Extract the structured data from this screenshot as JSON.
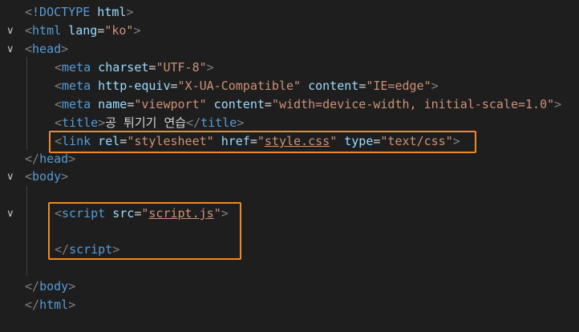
{
  "editor": {
    "lines": [
      {
        "fold": "",
        "tokens": [
          {
            "t": "<",
            "c": "t-br"
          },
          {
            "t": "!DOCTYPE",
            "c": "t-tag"
          },
          {
            "t": " html",
            "c": "t-attr"
          },
          {
            "t": ">",
            "c": "t-br"
          }
        ]
      },
      {
        "fold": "v",
        "tokens": [
          {
            "t": "<",
            "c": "t-br"
          },
          {
            "t": "html",
            "c": "t-tag"
          },
          {
            "t": " lang",
            "c": "t-attr"
          },
          {
            "t": "=",
            "c": "t-eq"
          },
          {
            "t": "\"ko\"",
            "c": "t-str"
          },
          {
            "t": ">",
            "c": "t-br"
          }
        ]
      },
      {
        "fold": "v",
        "tokens": [
          {
            "t": "<",
            "c": "t-br"
          },
          {
            "t": "head",
            "c": "t-tag"
          },
          {
            "t": ">",
            "c": "t-br"
          }
        ]
      },
      {
        "fold": "",
        "tokens": [
          {
            "t": "<",
            "c": "t-br"
          },
          {
            "t": "meta",
            "c": "t-tag"
          },
          {
            "t": " charset",
            "c": "t-attr"
          },
          {
            "t": "=",
            "c": "t-eq"
          },
          {
            "t": "\"UTF-8\"",
            "c": "t-str"
          },
          {
            "t": ">",
            "c": "t-br"
          }
        ]
      },
      {
        "fold": "",
        "tokens": [
          {
            "t": "<",
            "c": "t-br"
          },
          {
            "t": "meta",
            "c": "t-tag"
          },
          {
            "t": " http-equiv",
            "c": "t-attr"
          },
          {
            "t": "=",
            "c": "t-eq"
          },
          {
            "t": "\"X-UA-Compatible\"",
            "c": "t-str"
          },
          {
            "t": " content",
            "c": "t-attr"
          },
          {
            "t": "=",
            "c": "t-eq"
          },
          {
            "t": "\"IE=edge\"",
            "c": "t-str"
          },
          {
            "t": ">",
            "c": "t-br"
          }
        ]
      },
      {
        "fold": "",
        "tokens": [
          {
            "t": "<",
            "c": "t-br"
          },
          {
            "t": "meta",
            "c": "t-tag"
          },
          {
            "t": " name",
            "c": "t-attr"
          },
          {
            "t": "=",
            "c": "t-eq"
          },
          {
            "t": "\"viewport\"",
            "c": "t-str"
          },
          {
            "t": " content",
            "c": "t-attr"
          },
          {
            "t": "=",
            "c": "t-eq"
          },
          {
            "t": "\"width=device-width, initial-scale=1.0\"",
            "c": "t-str"
          },
          {
            "t": ">",
            "c": "t-br"
          }
        ]
      },
      {
        "fold": "",
        "tokens": [
          {
            "t": "<",
            "c": "t-br"
          },
          {
            "t": "title",
            "c": "t-tag"
          },
          {
            "t": ">",
            "c": "t-br"
          },
          {
            "t": "공 튀기기 연습",
            "c": "t-txt"
          },
          {
            "t": "</",
            "c": "t-br"
          },
          {
            "t": "title",
            "c": "t-tag"
          },
          {
            "t": ">",
            "c": "t-br"
          }
        ]
      },
      {
        "fold": "",
        "tokens": [
          {
            "t": "<",
            "c": "t-br"
          },
          {
            "t": "link",
            "c": "t-tag"
          },
          {
            "t": " rel",
            "c": "t-attr"
          },
          {
            "t": "=",
            "c": "t-eq"
          },
          {
            "t": "\"stylesheet\"",
            "c": "t-str"
          },
          {
            "t": " href",
            "c": "t-attr"
          },
          {
            "t": "=",
            "c": "t-eq"
          },
          {
            "t": "\"",
            "c": "t-str"
          },
          {
            "t": "style.css",
            "c": "t-str t-link"
          },
          {
            "t": "\"",
            "c": "t-str"
          },
          {
            "t": " type",
            "c": "t-attr"
          },
          {
            "t": "=",
            "c": "t-eq"
          },
          {
            "t": "\"text/css\"",
            "c": "t-str"
          },
          {
            "t": ">",
            "c": "t-br"
          }
        ]
      },
      {
        "fold": "",
        "tokens": [
          {
            "t": "</",
            "c": "t-br"
          },
          {
            "t": "head",
            "c": "t-tag"
          },
          {
            "t": ">",
            "c": "t-br"
          }
        ]
      },
      {
        "fold": "v",
        "tokens": [
          {
            "t": "<",
            "c": "t-br"
          },
          {
            "t": "body",
            "c": "t-tag"
          },
          {
            "t": ">",
            "c": "t-br"
          }
        ]
      },
      {
        "fold": "",
        "tokens": []
      },
      {
        "fold": "v",
        "tokens": [
          {
            "t": "<",
            "c": "t-br"
          },
          {
            "t": "script",
            "c": "t-tag"
          },
          {
            "t": " src",
            "c": "t-attr"
          },
          {
            "t": "=",
            "c": "t-eq"
          },
          {
            "t": "\"",
            "c": "t-str"
          },
          {
            "t": "script.js",
            "c": "t-str t-link"
          },
          {
            "t": "\"",
            "c": "t-str"
          },
          {
            "t": ">",
            "c": "t-br"
          }
        ]
      },
      {
        "fold": "",
        "tokens": []
      },
      {
        "fold": "",
        "tokens": [
          {
            "t": "</",
            "c": "t-br"
          },
          {
            "t": "script",
            "c": "t-tag"
          },
          {
            "t": ">",
            "c": "t-br"
          }
        ]
      },
      {
        "fold": "",
        "tokens": []
      },
      {
        "fold": "",
        "tokens": [
          {
            "t": "</",
            "c": "t-br"
          },
          {
            "t": "body",
            "c": "t-tag"
          },
          {
            "t": ">",
            "c": "t-br"
          }
        ]
      },
      {
        "fold": "",
        "tokens": [
          {
            "t": "</",
            "c": "t-br"
          },
          {
            "t": "html",
            "c": "t-tag"
          },
          {
            "t": ">",
            "c": "t-br"
          }
        ]
      }
    ],
    "highlight_color": "#f08a24"
  }
}
